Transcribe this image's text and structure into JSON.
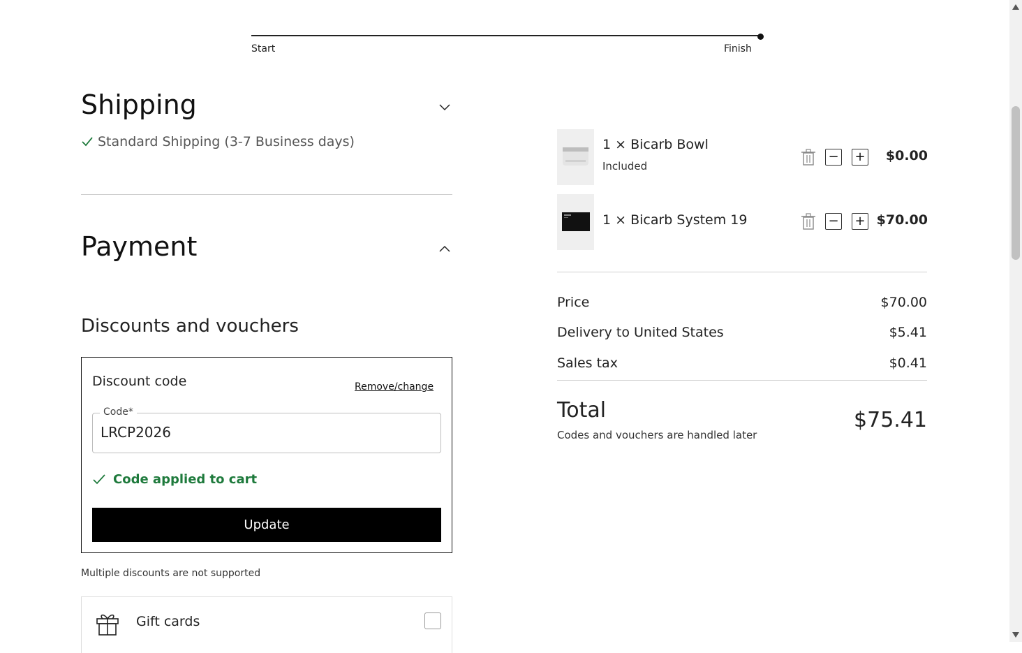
{
  "progress": {
    "start_label": "Start",
    "finish_label": "Finish"
  },
  "shipping": {
    "title": "Shipping",
    "selected_option": "Standard Shipping (3-7 Business days)"
  },
  "payment": {
    "title": "Payment",
    "discounts_title": "Discounts and vouchers",
    "discount_code_label": "Discount code",
    "remove_change_label": "Remove/change",
    "code_field_label": "Code*",
    "code_value": "LRCP2026",
    "code_applied_message": "Code applied to cart",
    "update_button_label": "Update",
    "multiple_discounts_note": "Multiple discounts are not supported",
    "gift_cards_label": "Gift cards"
  },
  "cart": {
    "items": [
      {
        "name": "1 × Bicarb Bowl",
        "subtitle": "Included",
        "price": "$0.00",
        "qty_minus": "−",
        "qty_plus": "+"
      },
      {
        "name": "1 × Bicarb System 19",
        "subtitle": "",
        "price": "$70.00",
        "qty_minus": "−",
        "qty_plus": "+"
      }
    ],
    "summary": {
      "price_label": "Price",
      "price_value": "$70.00",
      "delivery_label": "Delivery to United States",
      "delivery_value": "$5.41",
      "tax_label": "Sales tax",
      "tax_value": "$0.41",
      "total_label": "Total",
      "total_value": "$75.41",
      "total_note": "Codes and vouchers are handled later"
    }
  },
  "colors": {
    "accent_success": "#1e7a3c",
    "button_bg": "#000000"
  }
}
